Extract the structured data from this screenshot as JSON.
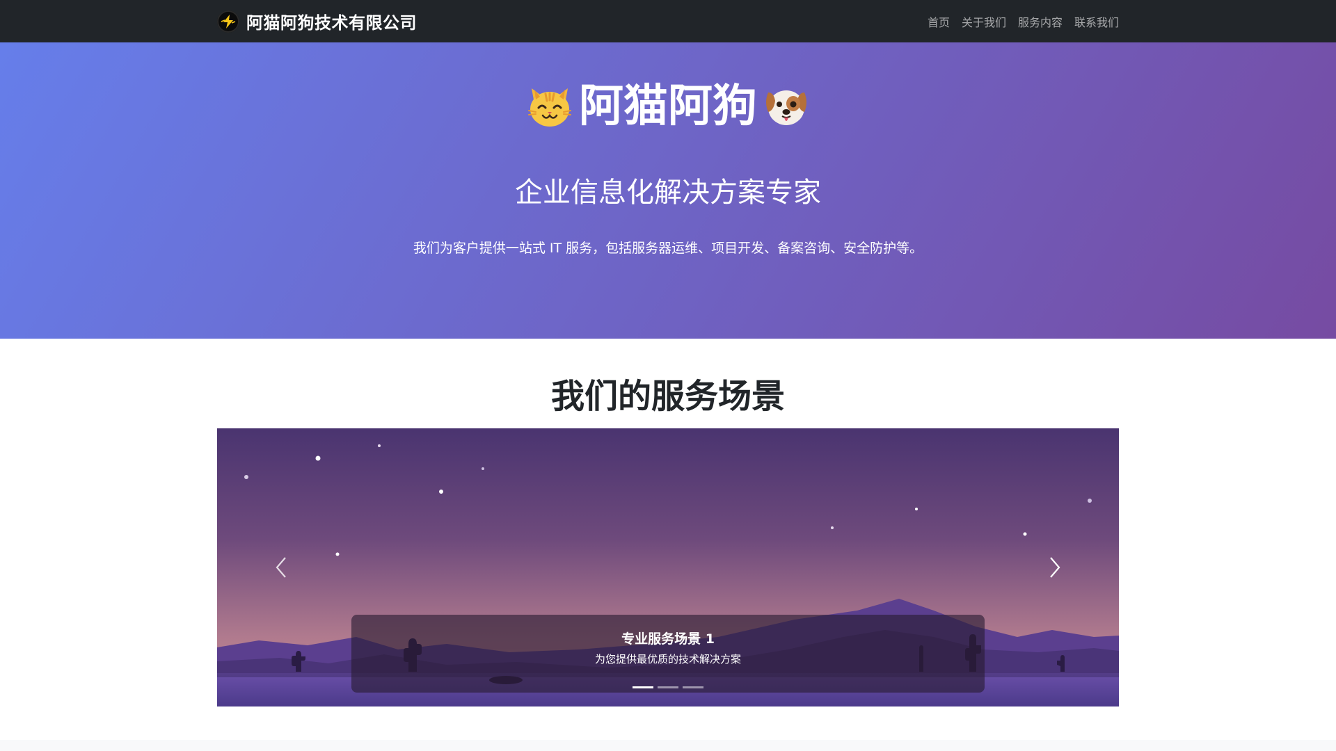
{
  "navbar": {
    "brand": "阿猫阿狗技术有限公司",
    "links": [
      "首页",
      "关于我们",
      "服务内容",
      "联系我们"
    ]
  },
  "hero": {
    "title": "阿猫阿狗",
    "subtitle": "企业信息化解决方案专家",
    "description": "我们为客户提供一站式 IT 服务，包括服务器运维、项目开发、备案咨询、安全防护等。"
  },
  "services": {
    "title": "我们的服务场景",
    "carousel": {
      "active_index": 0,
      "slide_count": 3,
      "caption_title": "专业服务场景 1",
      "caption_text": "为您提供最优质的技术解决方案"
    }
  },
  "colors": {
    "navbar": "#212529",
    "hero_start": "#667eea",
    "hero_end": "#764ba2"
  },
  "icons": [
    "lightning-logo-icon",
    "cat-face-icon",
    "dog-face-icon",
    "chevron-left-icon",
    "chevron-right-icon"
  ]
}
